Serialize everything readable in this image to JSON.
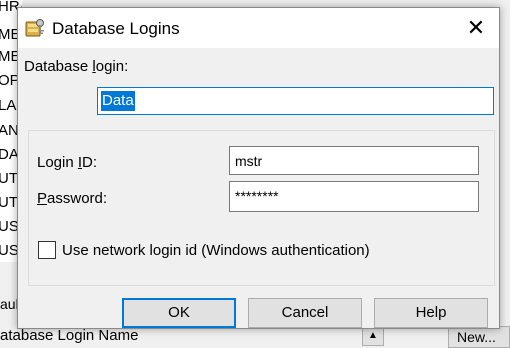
{
  "background": {
    "list_items": [
      "HRAM_WH_AG",
      "ME",
      "ME",
      "OPI",
      "LA",
      "AN",
      "DA",
      "UT",
      "UT",
      "USH",
      "USH"
    ],
    "bottom_label": "aul",
    "bottom_label2": "atabase Login Name",
    "new_button_label": "New...",
    "updown_label": "▲"
  },
  "dialog": {
    "title": "Database Logins",
    "close_label": "✕",
    "database_login": {
      "label_pre": "Database ",
      "label_ul": "l",
      "label_post": "ogin:",
      "value": "Data"
    },
    "login_id": {
      "label_pre": "Login ",
      "label_ul": "I",
      "label_post": "D:",
      "value": "mstr"
    },
    "password": {
      "label_pre": "",
      "label_ul": "P",
      "label_post": "assword:",
      "value": "********"
    },
    "checkbox": {
      "label": "Use network login id (Windows authentication)",
      "checked": false
    },
    "buttons": {
      "ok": "OK",
      "cancel": "Cancel",
      "help": "Help"
    }
  }
}
